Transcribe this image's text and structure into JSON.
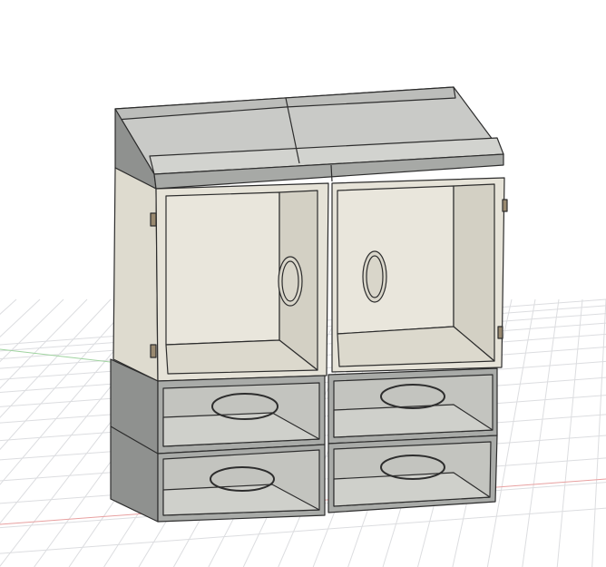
{
  "viewport": {
    "colors": {
      "background": "#ffffff",
      "grid": "#dcdde0",
      "axis_red": "#e8a0a0",
      "axis_green": "#9fd39f",
      "panel_beige": "#e4e1d6",
      "interior_beige": "#d6d3c6",
      "side_gray": "#8f918f",
      "tray_gray": "#b4b6b3",
      "edge": "#2d2d2d"
    }
  }
}
